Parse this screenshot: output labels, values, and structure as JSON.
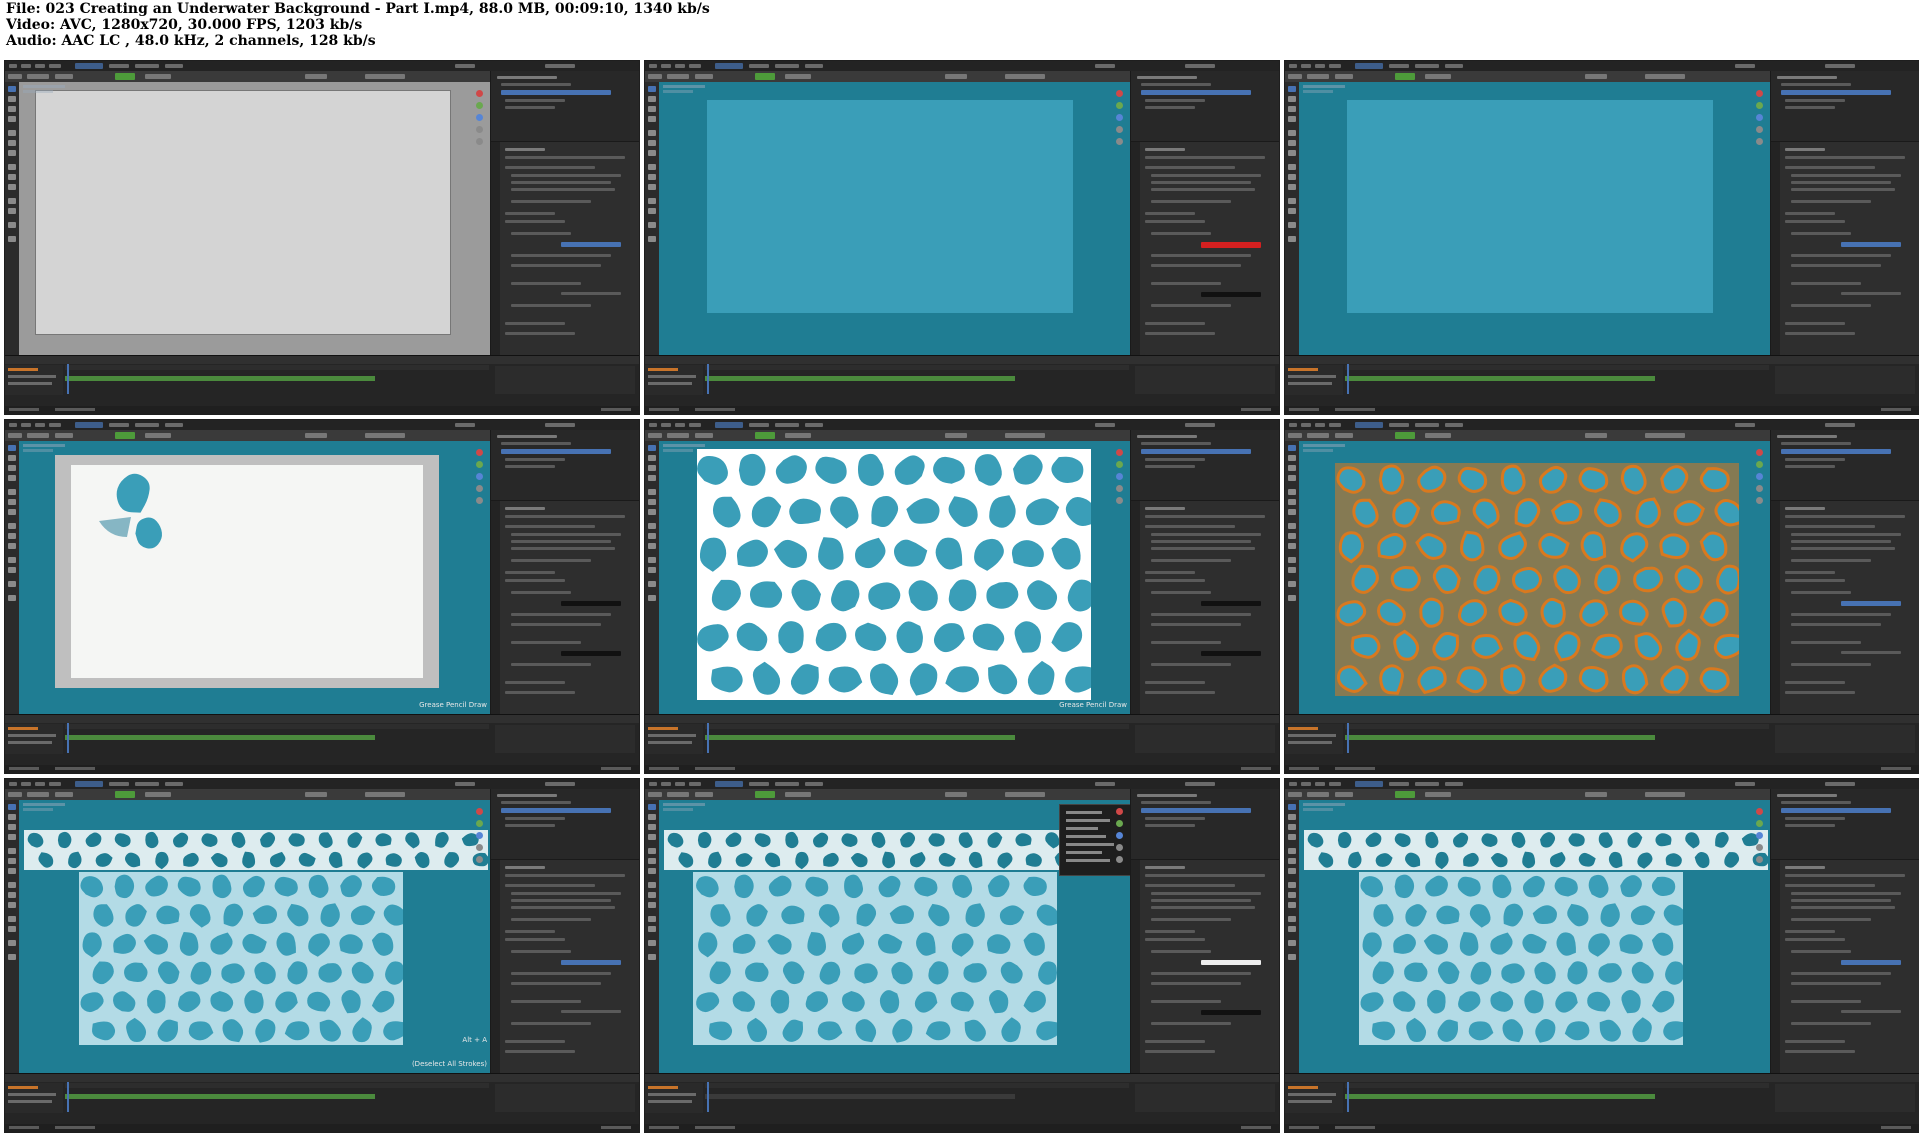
{
  "header": {
    "file": "File: 023 Creating an Underwater Background - Part I.mp4, 88.0 MB, 00:09:10, 1340 kb/s",
    "video": "Video: AVC, 1280x720, 30.000 FPS, 1203 kb/s",
    "audio": "Audio: AAC LC , 48.0 kHz, 2 channels, 128 kb/s"
  },
  "thumbnails": [
    {
      "scene": "blank-canvas",
      "label": ""
    },
    {
      "scene": "blue-plane",
      "label": ""
    },
    {
      "scene": "blue-plane",
      "label": ""
    },
    {
      "scene": "first-shapes",
      "label": "Grease Pencil Draw"
    },
    {
      "scene": "cell-pattern",
      "label": "Grease Pencil Draw"
    },
    {
      "scene": "orange-pattern",
      "label": ""
    },
    {
      "scene": "perspective-pattern",
      "label": "(Deselect All Strokes)",
      "shortcut": "Alt + A"
    },
    {
      "scene": "perspective-pattern-menu",
      "label": ""
    },
    {
      "scene": "perspective-pattern",
      "label": ""
    }
  ],
  "colors": {
    "water": "#3a9eb8",
    "water_dark": "#1f7d93",
    "canvas_gray": "#d4d4d4",
    "canvas_white": "#f5f6f4",
    "accent_red": "#d42020",
    "accent_orange": "#d8791f",
    "blender_blue": "#4772b3"
  }
}
